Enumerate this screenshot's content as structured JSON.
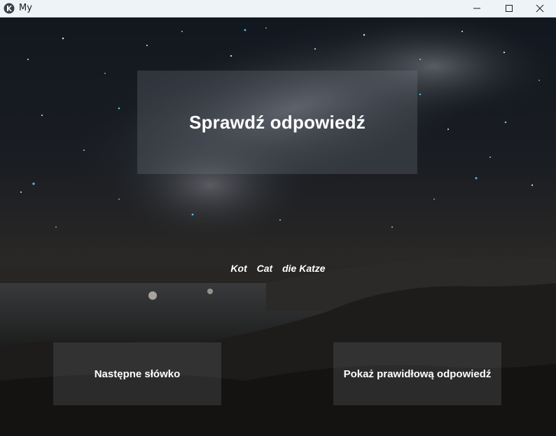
{
  "window": {
    "title": "My",
    "icons": {
      "app": "app-logo-icon",
      "minimize": "minimize-icon",
      "maximize": "maximize-icon",
      "close": "close-icon"
    }
  },
  "main": {
    "heading": "Sprawdź odpowiedź",
    "words": [
      "Kot",
      "Cat",
      "die Katze"
    ],
    "buttons": {
      "next": "Następne słówko",
      "show_answer": "Pokaż prawidłową odpowiedź"
    }
  },
  "colors": {
    "titlebar": "#eef3f8",
    "text": "#ffffff",
    "panel": "rgba(120,125,135,0.28)",
    "button": "rgba(95,95,100,0.32)"
  }
}
